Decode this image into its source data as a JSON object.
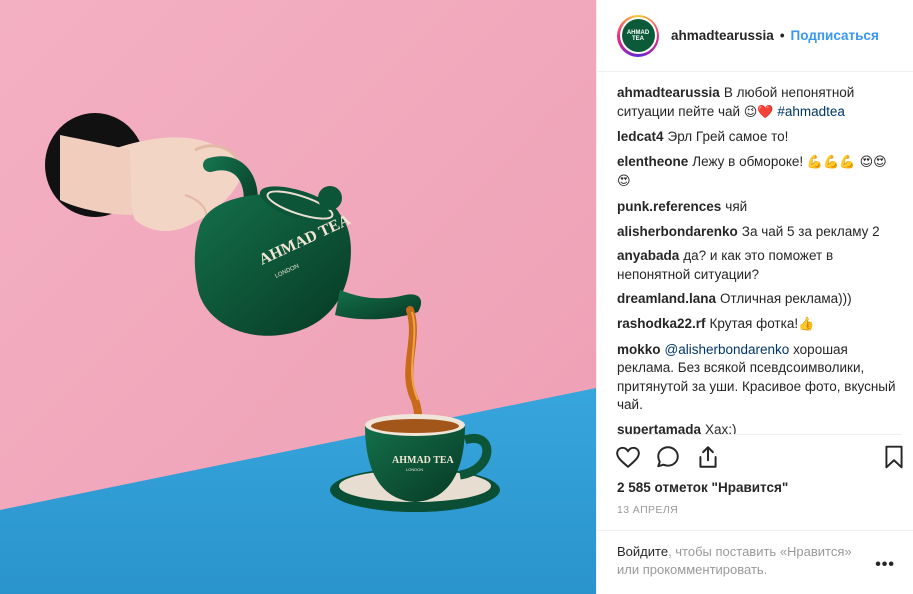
{
  "post": {
    "username": "ahmadtearussia",
    "follow_label": "Подписаться",
    "separator": "•",
    "avatar_text": "AHMAD TEA",
    "photo": {
      "teapot_brand": "AHMAD TEA",
      "teapot_city": "LONDON",
      "cup_brand": "AHMAD TEA",
      "cup_city": "LONDON"
    },
    "caption": {
      "user": "ahmadtearussia",
      "text": "В любой непонятной ситуации пейте чай",
      "emoji": "😉❤️",
      "hashtag": "#ahmadtea"
    },
    "comments": [
      {
        "user": "ledcat4",
        "text": "Эрл Грей самое то!"
      },
      {
        "user": "elentheone",
        "text": "Лежу в обмороке!",
        "emoji": "💪💪💪 😍😍😍"
      },
      {
        "user": "punk.references",
        "text": "чяй"
      },
      {
        "user": "alisherbondarenko",
        "text": "За чай 5 за рекламу 2"
      },
      {
        "user": "anyabada",
        "text": "да? и как это поможет в непонятной ситуации?"
      },
      {
        "user": "dreamland.lana",
        "text": "Отличная реклама)))"
      },
      {
        "user": "rashodka22.rf",
        "text": "Крутая фотка!",
        "emoji": "👍"
      },
      {
        "user": "mokko",
        "mention": "@alisherbondarenko",
        "text": "хорошая реклама. Без всякой псевдсоимволики, притянутой за уши. Красивое фото, вкусный чай."
      },
      {
        "user": "supertamada",
        "text": "Хах;)"
      }
    ],
    "likes": "2 585 отметок \"Нравится\"",
    "date": "13 апреля",
    "login_prompt": {
      "link": "Войдите",
      "text": ", чтобы поставить «Нравится» или прокомментировать."
    },
    "more_label": "•••"
  },
  "colors": {
    "pink_wall": "#f2a9bd",
    "blue_table": "#2f9fd6",
    "teapot_green": "#0b4a33",
    "tea": "#c76b1a",
    "link_blue": "#3897f0"
  },
  "icons": [
    "heart-icon",
    "comment-icon",
    "share-icon",
    "bookmark-icon"
  ]
}
